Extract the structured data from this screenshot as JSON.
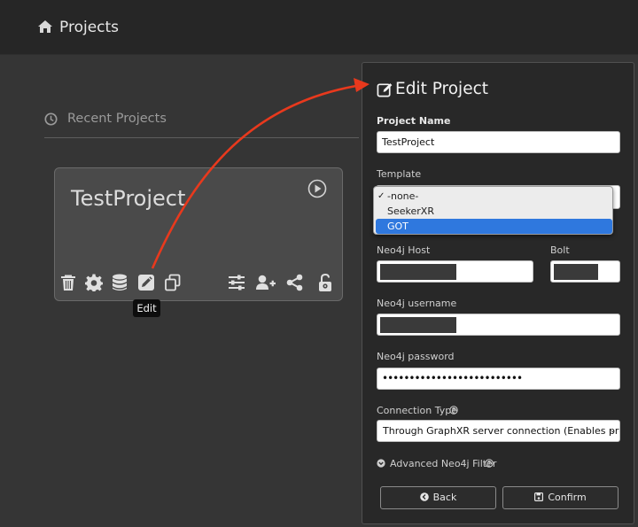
{
  "topbar": {
    "title": "Projects",
    "icon": "home-icon"
  },
  "recent": {
    "label": "Recent Projects",
    "icon": "clock-icon"
  },
  "card": {
    "name": "TestProject",
    "tools": [
      "trash-icon",
      "gear-icon",
      "database-icon",
      "edit-icon",
      "clone-icon",
      "sliders-icon",
      "user-plus-icon",
      "share-icon",
      "unlock-icon"
    ]
  },
  "tooltip": {
    "text": "Edit"
  },
  "panel": {
    "title": "Edit Project",
    "project_name_label": "Project Name",
    "project_name_value": "TestProject",
    "template_label": "Template",
    "template_options": [
      "-none-",
      "SeekerXR",
      "GOT"
    ],
    "template_checked": "-none-",
    "template_highlighted": "GOT",
    "neo4j_host_label": "Neo4j Host",
    "bolt_label": "Bolt",
    "neo4j_username_label": "Neo4j username",
    "neo4j_password_label": "Neo4j password",
    "neo4j_password_value": "••••••••••••••••••••••••••",
    "connection_type_label": "Connection Type",
    "connection_type_value": "Through GraphXR server connection (Enables project sha",
    "advanced_label": "Advanced Neo4j Filter",
    "back_label": "Back",
    "confirm_label": "Confirm"
  },
  "colors": {
    "annotation_arrow": "#e8391d",
    "selected_option": "#2f78de"
  }
}
